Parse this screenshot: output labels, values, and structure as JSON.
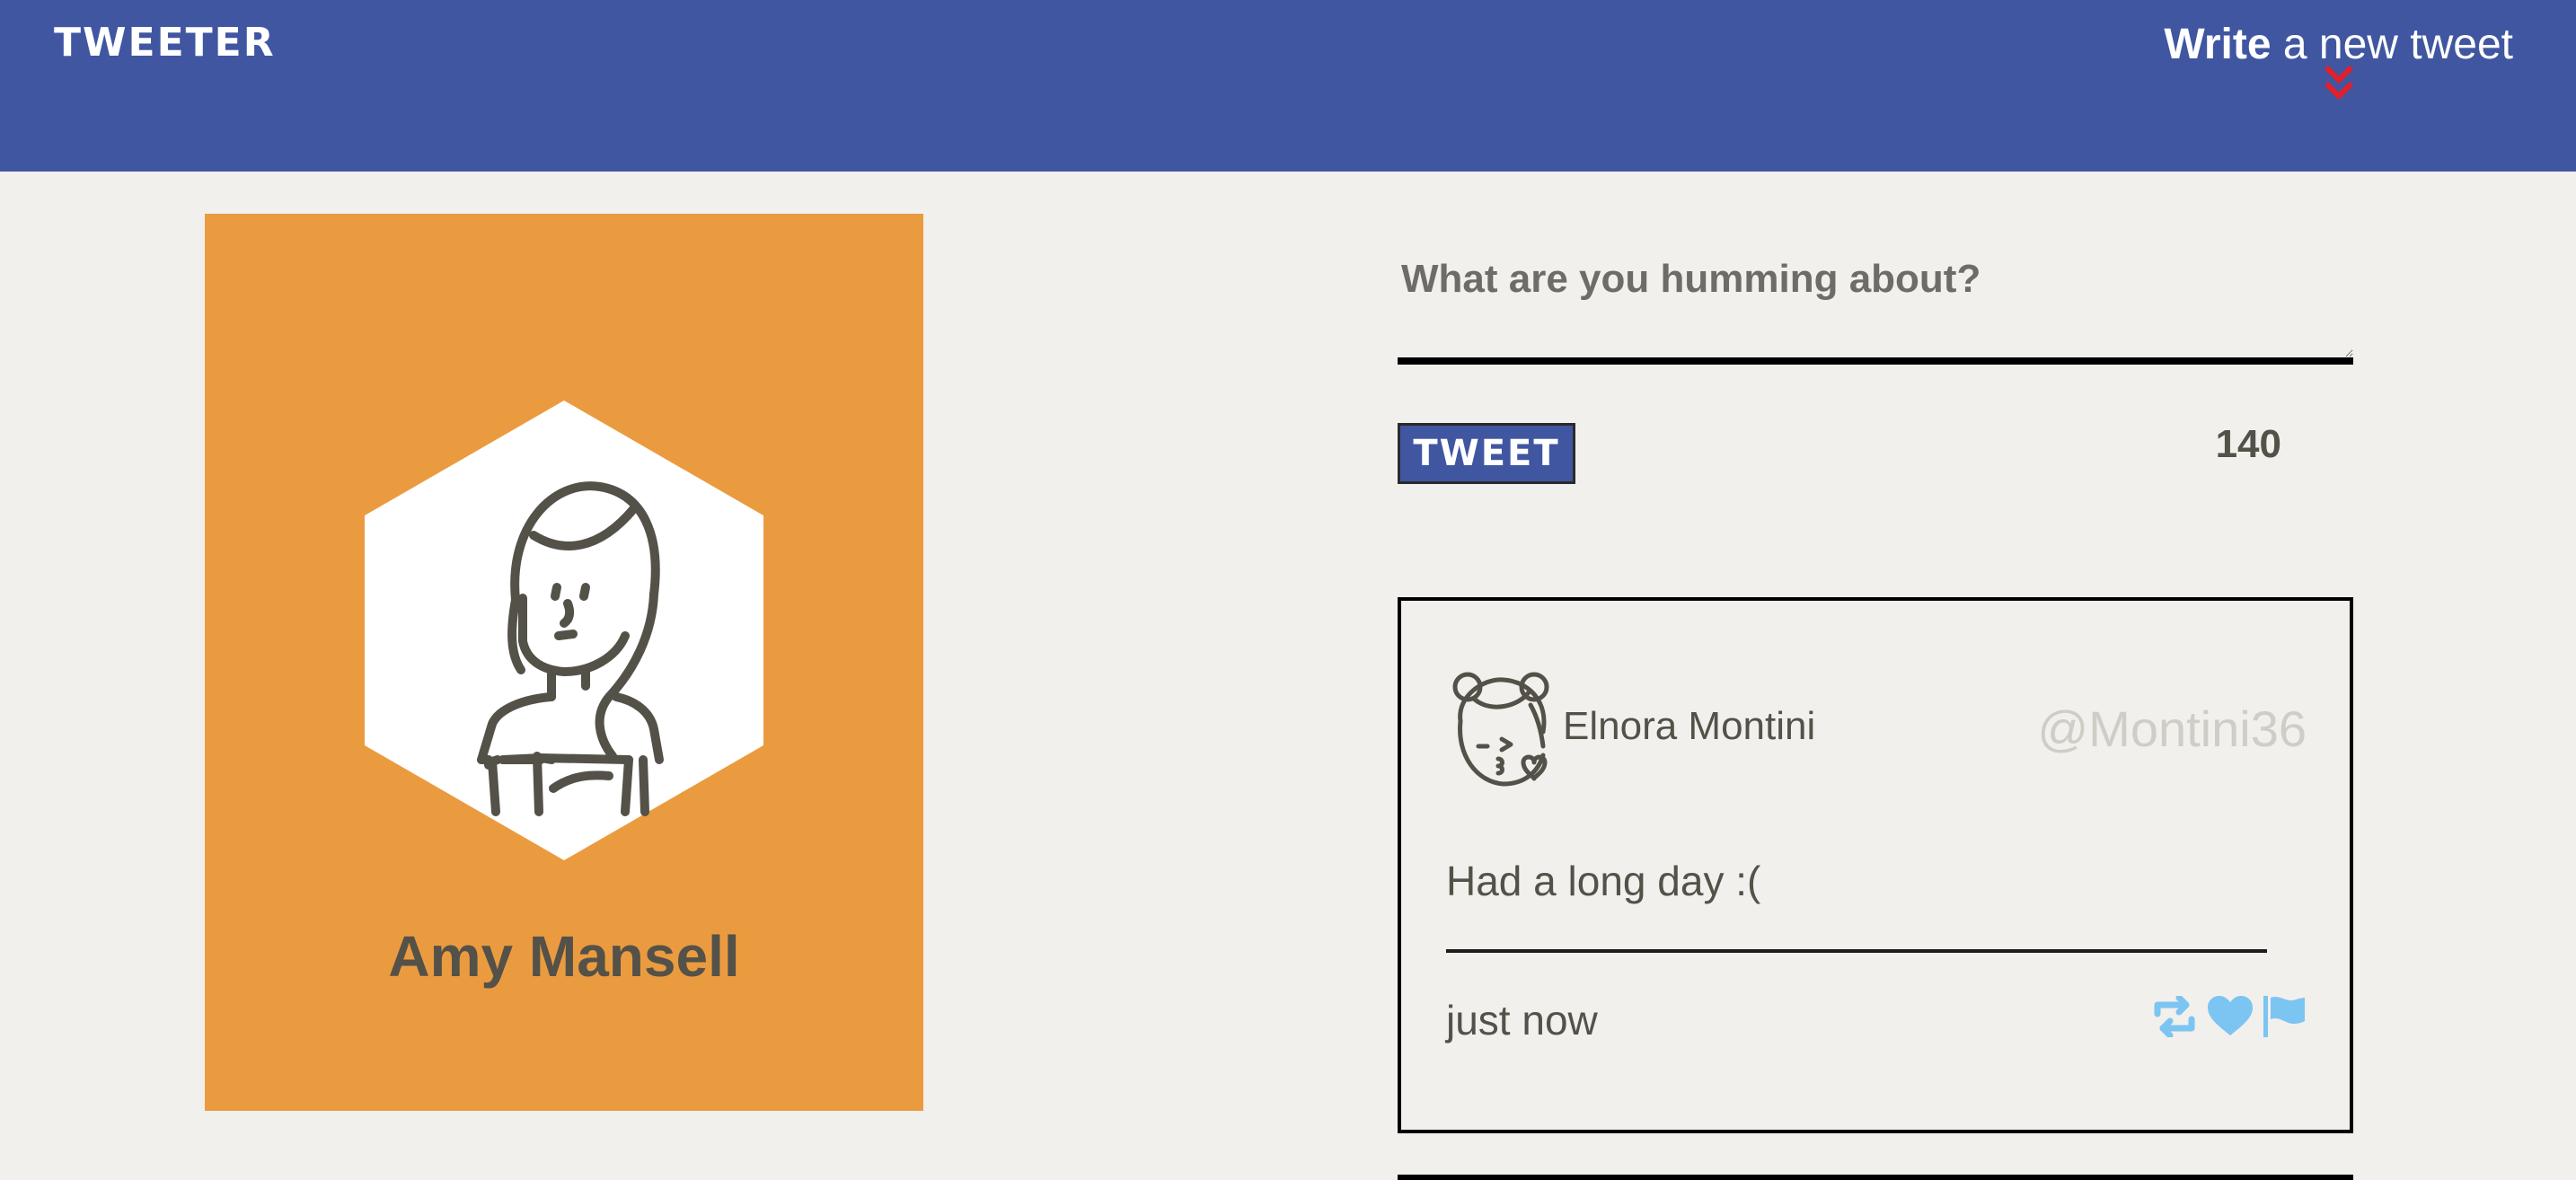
{
  "header": {
    "logo": "TWEETER",
    "compose_bold": "Write",
    "compose_rest": " a new tweet",
    "compose_icon": "double-chevron-down-icon"
  },
  "profile": {
    "name": "Amy Mansell",
    "avatar_icon": "woman-avatar-icon",
    "card_color": "#eb9b3f"
  },
  "compose": {
    "placeholder": "What are you humming about?",
    "value": "",
    "button_label": "TWEET",
    "counter": "140"
  },
  "tweets": [
    {
      "author": "Elnora Montini",
      "handle": "@Montini36",
      "avatar_icon": "girl-kiss-avatar-icon",
      "text": "Had a long day :(",
      "time": "just now",
      "actions": [
        "retweet-icon",
        "heart-icon",
        "flag-icon"
      ]
    }
  ],
  "colors": {
    "header": "#4056a1",
    "background": "#f1f0ec",
    "accent_red": "#e0202a",
    "action_blue": "#7cc4f2"
  }
}
